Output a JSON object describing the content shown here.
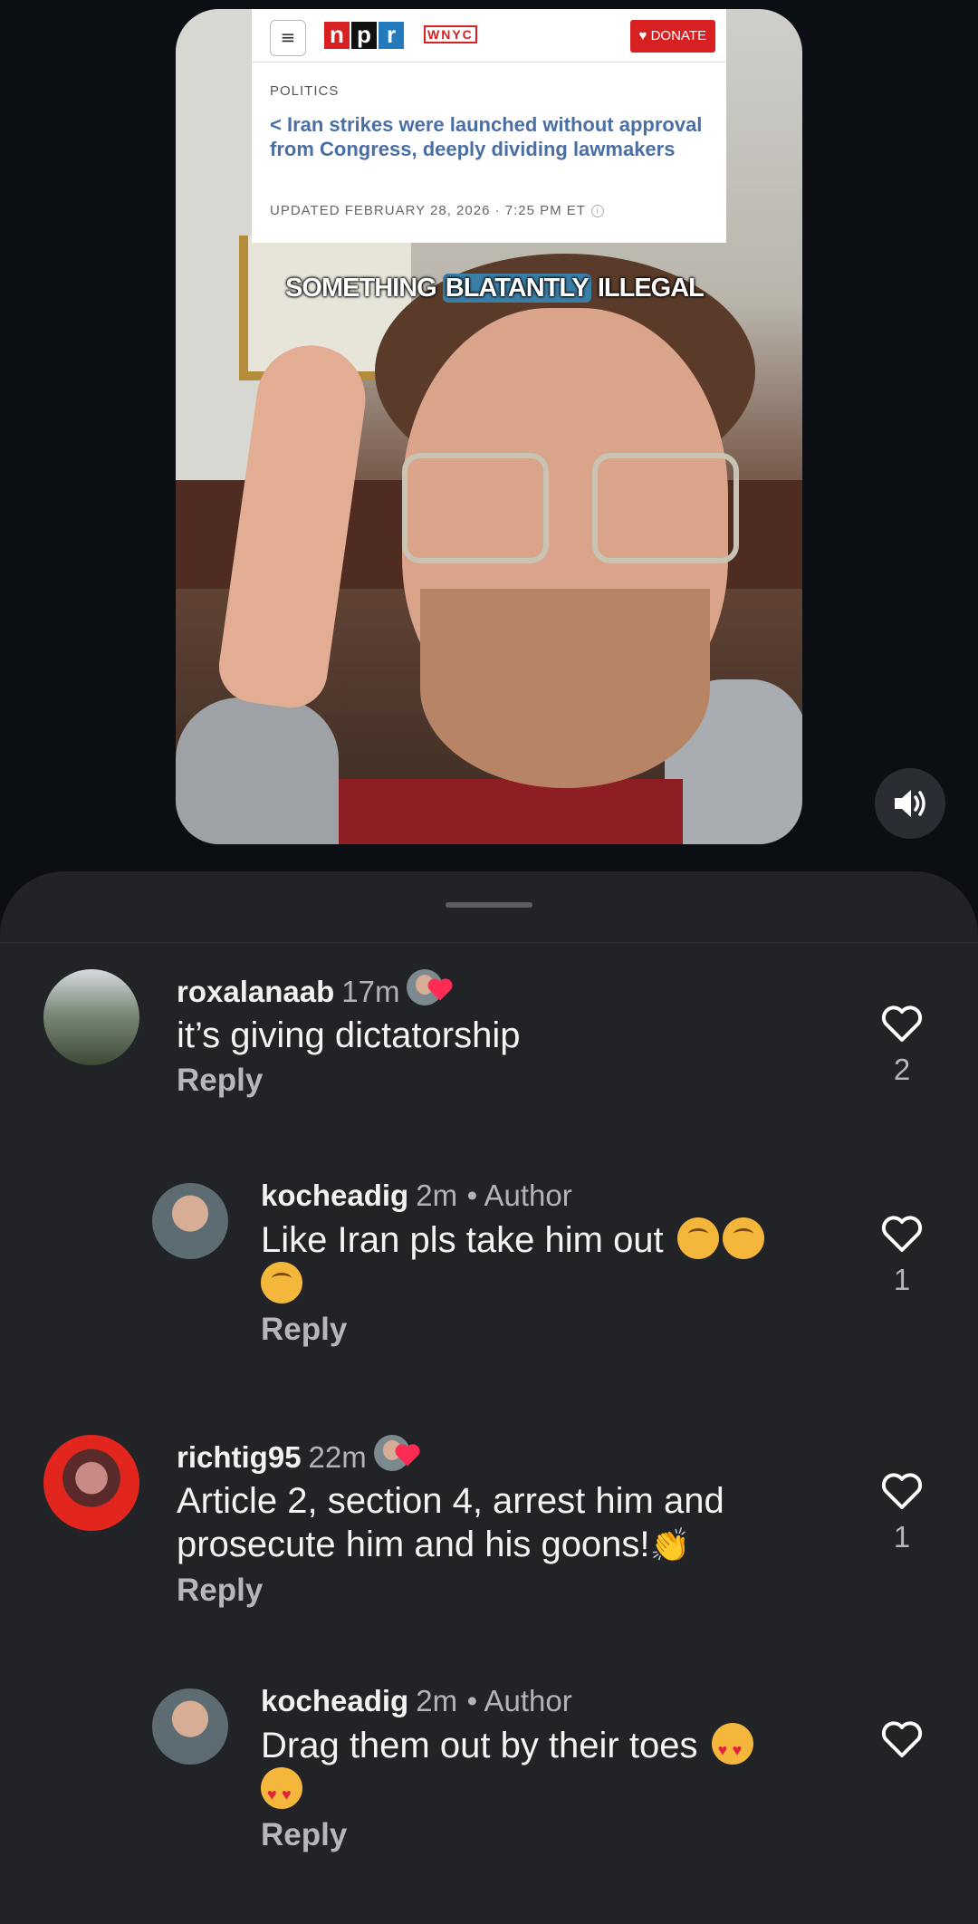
{
  "video": {
    "news": {
      "outlet_left": "npr",
      "outlet_right": "WNYC",
      "donate_label": "DONATE",
      "section": "POLITICS",
      "headline": "< Iran strikes were launched without approval from Congress, deeply dividing lawmakers",
      "updated": "UPDATED FEBRUARY 28, 2026 · 7:25 PM ET"
    },
    "caption": {
      "before": "SOMETHING ",
      "highlight": "BLATANTLY",
      "after": " ILLEGAL"
    },
    "volume_icon": "speaker-volume-icon"
  },
  "comments": [
    {
      "username": "roxalanaab",
      "time": "17m",
      "author_tag": "",
      "liked_by_creator": true,
      "text": "it’s giving dictatorship",
      "reply_label": "Reply",
      "likes": "2"
    },
    {
      "username": "kocheadig",
      "time": "2m",
      "author_tag": "• Author",
      "text_line1": "Like Iran pls take him out",
      "reply_label": "Reply",
      "likes": "1"
    },
    {
      "username": "richtig95",
      "time": "22m",
      "liked_by_creator": true,
      "text_line1": "Article 2, section 4, arrest him and",
      "text_line2": "prosecute him and his goons!",
      "reply_label": "Reply",
      "likes": "1"
    },
    {
      "username": "kocheadig",
      "time": "2m",
      "author_tag": "• Author",
      "text_line1": "Drag them out by their toes",
      "reply_label": "Reply",
      "likes": ""
    }
  ],
  "colors": {
    "background": "#0b0f14",
    "sheet": "#222327",
    "creator_heart": "#fe2c55"
  }
}
